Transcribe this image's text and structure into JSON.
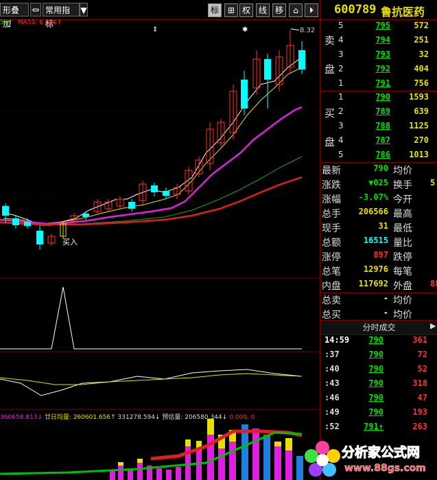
{
  "toolbar": {
    "left_btn": "形叠加",
    "indicator_btn": "常用指标",
    "buttons": [
      "标",
      "⊞",
      "权",
      "线",
      "移"
    ]
  },
  "price_chart": {
    "indicator_label_1": "59↑",
    "indicator_label_2": "MA55: 6.856↑",
    "high_label": "8.32",
    "buy_label": "买入"
  },
  "volume_panel": {
    "labels": [
      "360658.813↓",
      "廿日均量: 260601.656↑",
      "331278.594↓",
      "预估量: 206580.344↓",
      "0.000,",
      "0"
    ]
  },
  "quote": {
    "code": "600789",
    "name": "鲁抗医药",
    "sell_label": [
      "卖",
      "盘"
    ],
    "buy_label": [
      "买",
      "盘"
    ],
    "sells": [
      {
        "level": "5",
        "price": "795",
        "volume": "572"
      },
      {
        "level": "4",
        "price": "794",
        "volume": "251"
      },
      {
        "level": "3",
        "price": "793",
        "volume": "32"
      },
      {
        "level": "2",
        "price": "792",
        "volume": "404"
      },
      {
        "level": "1",
        "price": "791",
        "volume": "756"
      }
    ],
    "buys": [
      {
        "level": "1",
        "price": "790",
        "volume": "1593"
      },
      {
        "level": "2",
        "price": "789",
        "volume": "639"
      },
      {
        "level": "3",
        "price": "788",
        "volume": "1125"
      },
      {
        "level": "4",
        "price": "787",
        "volume": "270"
      },
      {
        "level": "5",
        "price": "786",
        "volume": "1013"
      }
    ],
    "stats": [
      {
        "l1": "最新",
        "v1": "790",
        "l2": "均价",
        "v2": ""
      },
      {
        "l1": "涨跌",
        "v1": "▼025",
        "l2": "换手",
        "v2": "5."
      },
      {
        "l1": "涨幅",
        "v1": "-3.07%",
        "l2": "今开",
        "v2": ""
      },
      {
        "l1": "总手",
        "v1": "206566",
        "l2": "最高",
        "v2": ""
      },
      {
        "l1": "现手",
        "v1": "31",
        "l2": "最低",
        "v2": ""
      },
      {
        "l1": "总额",
        "v1": "16515",
        "l2": "量比",
        "v2": ""
      },
      {
        "l1": "涨停",
        "v1": "897",
        "l2": "跌停",
        "v2": ""
      },
      {
        "l1": "总笔",
        "v1": "12976",
        "l2": "每笔",
        "v2": ""
      },
      {
        "l1": "内盘",
        "v1": "117692",
        "l2": "外盘",
        "v2": "88"
      }
    ],
    "totals": [
      {
        "l1": "总卖",
        "v1": "-",
        "l2": "均价"
      },
      {
        "l1": "总买",
        "v1": "-",
        "l2": "均价"
      }
    ],
    "ticks_title": "分时成交",
    "ticks": [
      {
        "time": "14:59",
        "price": "790",
        "vol": "361",
        "dir": "red"
      },
      {
        "time": ":37",
        "price": "790",
        "vol": "72",
        "dir": "red"
      },
      {
        "time": ":40",
        "price": "790",
        "vol": "52",
        "dir": "red"
      },
      {
        "time": ":43",
        "price": "790",
        "vol": "318",
        "dir": "red"
      },
      {
        "time": ":46",
        "price": "790",
        "vol": "47",
        "dir": "red"
      },
      {
        "time": ":49",
        "price": "790",
        "vol": "193",
        "dir": "red"
      },
      {
        "time": ":52",
        "price": "791↑",
        "vol": "263",
        "dir": "red"
      }
    ]
  },
  "watermark": {
    "title": "分析家公式网",
    "url": "www.88gs.com"
  }
}
